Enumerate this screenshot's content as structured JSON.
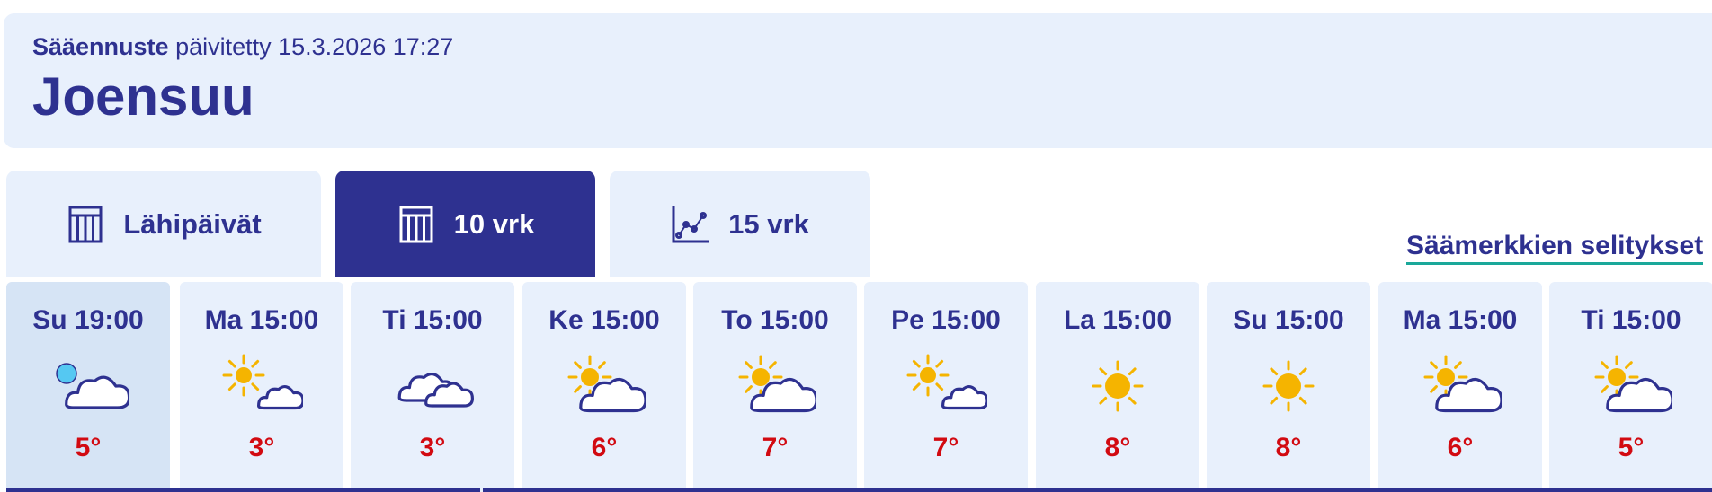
{
  "header": {
    "label": "Sääennuste",
    "updated": "päivitetty 15.3.2026 17:27",
    "city": "Joensuu"
  },
  "tabs": [
    {
      "label": "Lähipäivät",
      "icon": "table-icon",
      "active": false
    },
    {
      "label": "10 vrk",
      "icon": "table-icon",
      "active": true
    },
    {
      "label": "15 vrk",
      "icon": "line-chart-icon",
      "active": false
    }
  ],
  "legend_link": "Säämerkkien selitykset",
  "forecast": [
    {
      "time": "Su 19:00",
      "icon": "night-partly-cloudy-icon",
      "temp": "5°"
    },
    {
      "time": "Ma 15:00",
      "icon": "sun-small-cloud-icon",
      "temp": "3°"
    },
    {
      "time": "Ti 15:00",
      "icon": "cloudy-icon",
      "temp": "3°"
    },
    {
      "time": "Ke 15:00",
      "icon": "partly-cloudy-icon",
      "temp": "6°"
    },
    {
      "time": "To 15:00",
      "icon": "partly-cloudy-icon",
      "temp": "7°"
    },
    {
      "time": "Pe 15:00",
      "icon": "sun-small-cloud-icon",
      "temp": "7°"
    },
    {
      "time": "La 15:00",
      "icon": "sunny-icon",
      "temp": "8°"
    },
    {
      "time": "Su 15:00",
      "icon": "sunny-icon",
      "temp": "8°"
    },
    {
      "time": "Ma 15:00",
      "icon": "partly-cloudy-icon",
      "temp": "6°"
    },
    {
      "time": "Ti 15:00",
      "icon": "partly-cloudy-icon",
      "temp": "5°"
    }
  ],
  "colors": {
    "brand": "#2e3190",
    "panel": "#e8f0fc",
    "current_panel": "#d6e4f5",
    "temperature": "#d20a11",
    "sun": "#f5b400",
    "moon": "#55c8f2",
    "link_underline": "#1aa89a"
  }
}
